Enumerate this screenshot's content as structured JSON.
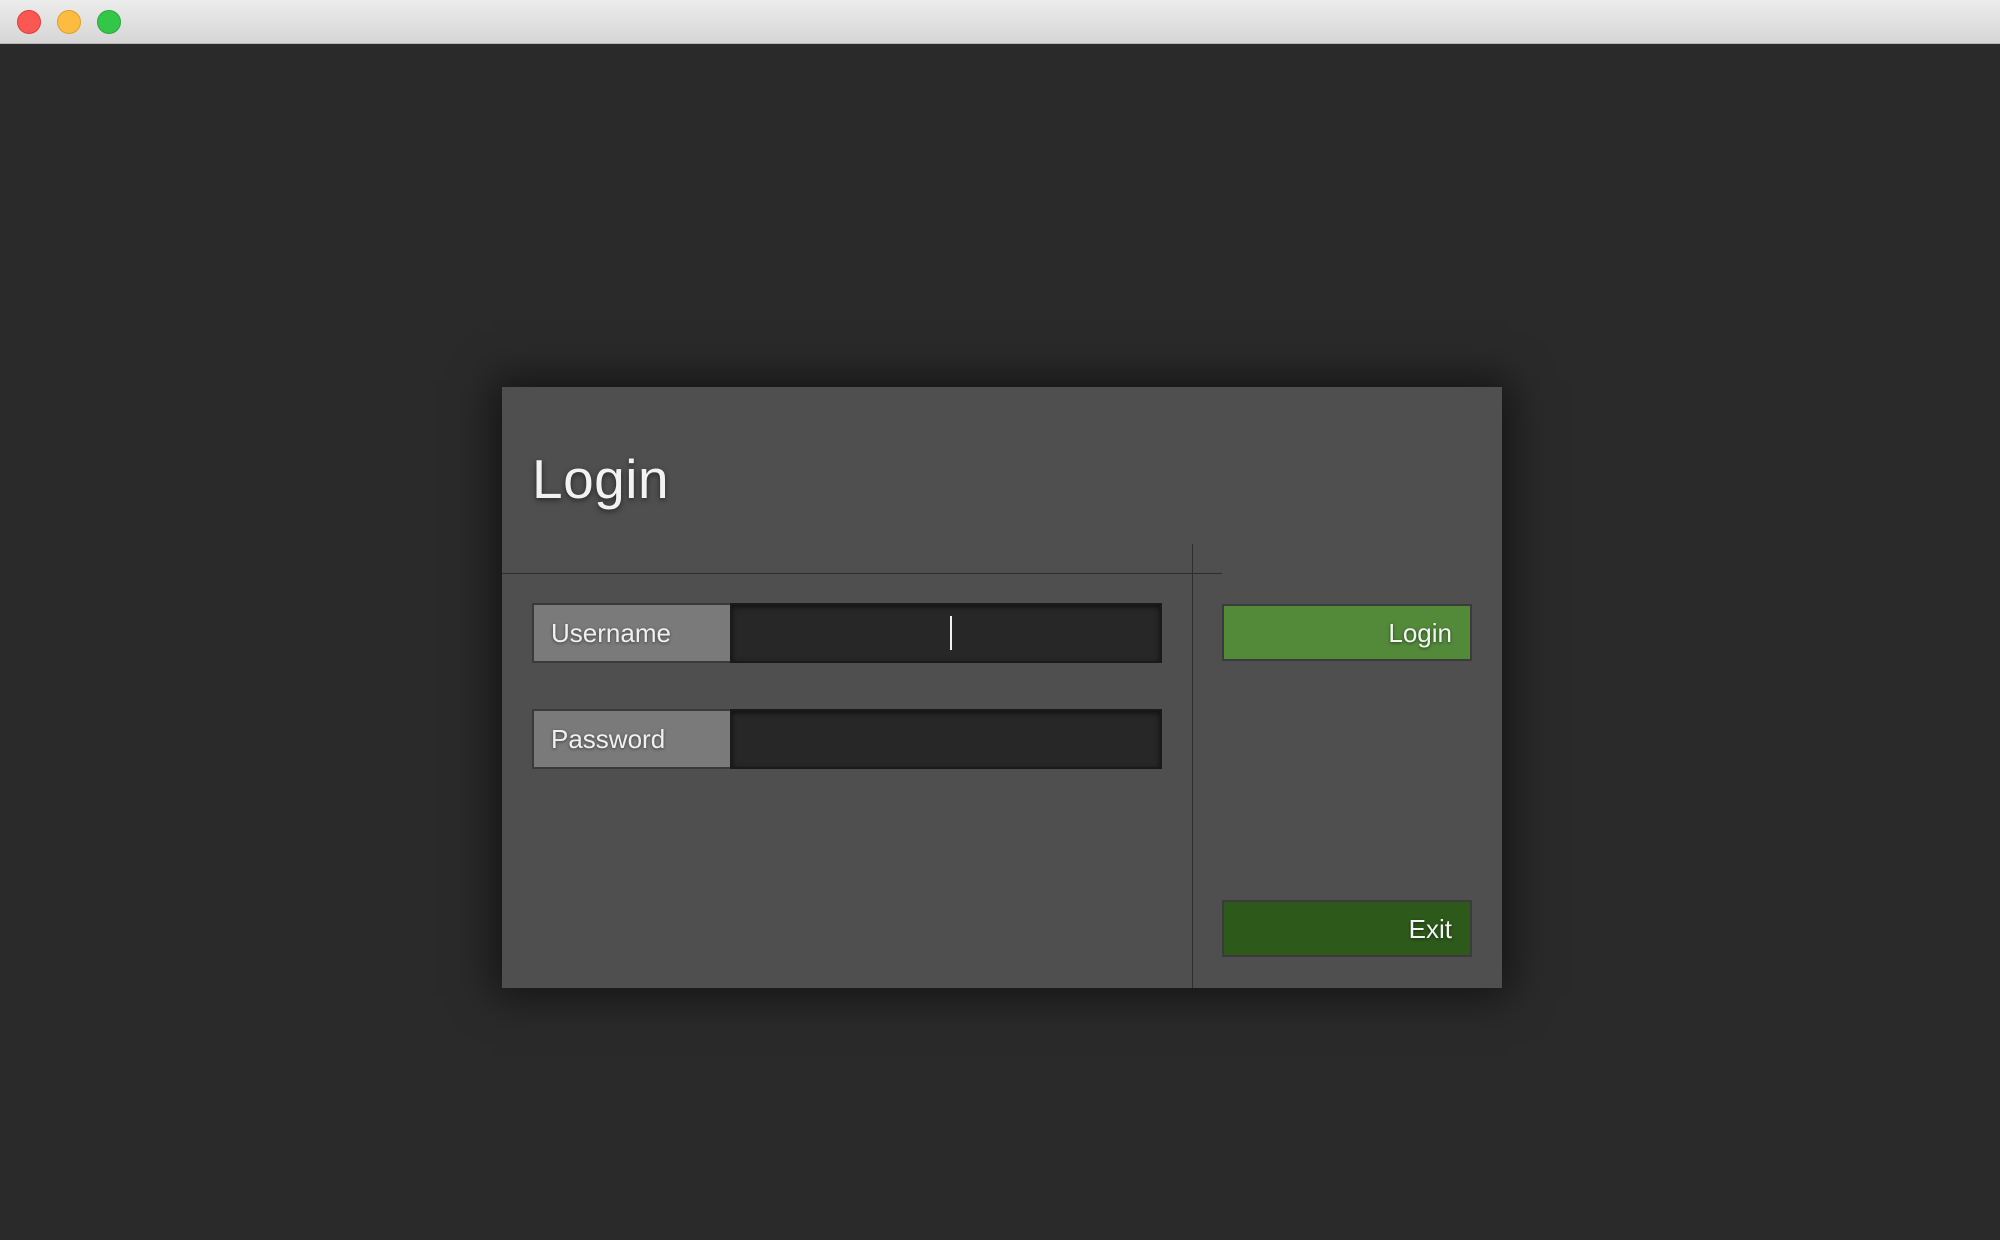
{
  "window": {
    "controls": {
      "close_icon": "close-icon",
      "minimize_icon": "minimize-icon",
      "maximize_icon": "maximize-icon"
    }
  },
  "dialog": {
    "title": "Login",
    "username": {
      "label": "Username",
      "value": "",
      "placeholder": ""
    },
    "password": {
      "label": "Password",
      "value": "",
      "placeholder": ""
    },
    "buttons": {
      "login_label": "Login",
      "exit_label": "Exit"
    }
  },
  "colors": {
    "background": "#2a2a2a",
    "dialog": "#4f4f4f",
    "login_button": "#528a3a",
    "exit_button": "#2d5a1a",
    "label_bg": "#7a7a7a",
    "input_bg": "#272727"
  }
}
